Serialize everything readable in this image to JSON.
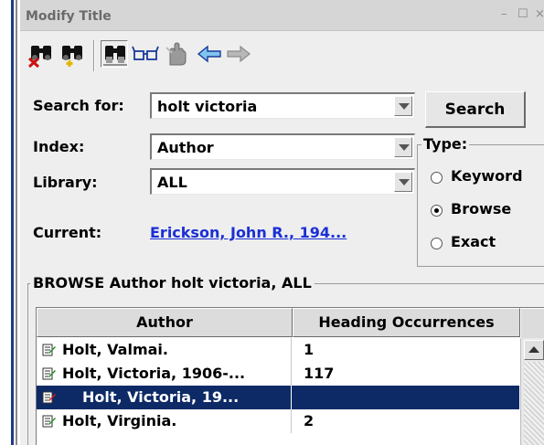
{
  "window": {
    "title": "Modify Title",
    "min_glyph": "–",
    "max_glyph": "☐",
    "close_glyph": "×"
  },
  "toolbar": {
    "icons": [
      "binoculars-remove-icon",
      "binoculars-add-icon",
      "binoculars-search-icon",
      "glasses-icon",
      "hand-icon",
      "arrow-left-icon",
      "arrow-right-icon"
    ]
  },
  "form": {
    "search_for_label": "Search for:",
    "search_for_value": "holt victoria",
    "index_label": "Index:",
    "index_value": "Author",
    "library_label": "Library:",
    "library_value": "ALL",
    "current_label": "Current:",
    "current_link": "Erickson, John R., 194...",
    "search_button": "Search"
  },
  "type_group": {
    "legend": "Type:",
    "options": [
      {
        "label": "Keyword",
        "selected": false
      },
      {
        "label": "Browse",
        "selected": true
      },
      {
        "label": "Exact",
        "selected": false
      }
    ]
  },
  "browse": {
    "legend": "BROWSE Author holt victoria, ALL",
    "columns": [
      "Author",
      "Heading Occurrences"
    ],
    "rows": [
      {
        "author": "Holt, Valmai.",
        "occurrences": "1",
        "selected": false
      },
      {
        "author": "Holt, Victoria, 1906-...",
        "occurrences": "117",
        "selected": false
      },
      {
        "author": "Holt, Victoria, 19...",
        "occurrences": "",
        "selected": true
      },
      {
        "author": "Holt, Virginia.",
        "occurrences": "2",
        "selected": false
      }
    ]
  },
  "colors": {
    "selection": "#0e2a66",
    "link": "#1a2fd6",
    "window_bg": "#eeeeee"
  }
}
